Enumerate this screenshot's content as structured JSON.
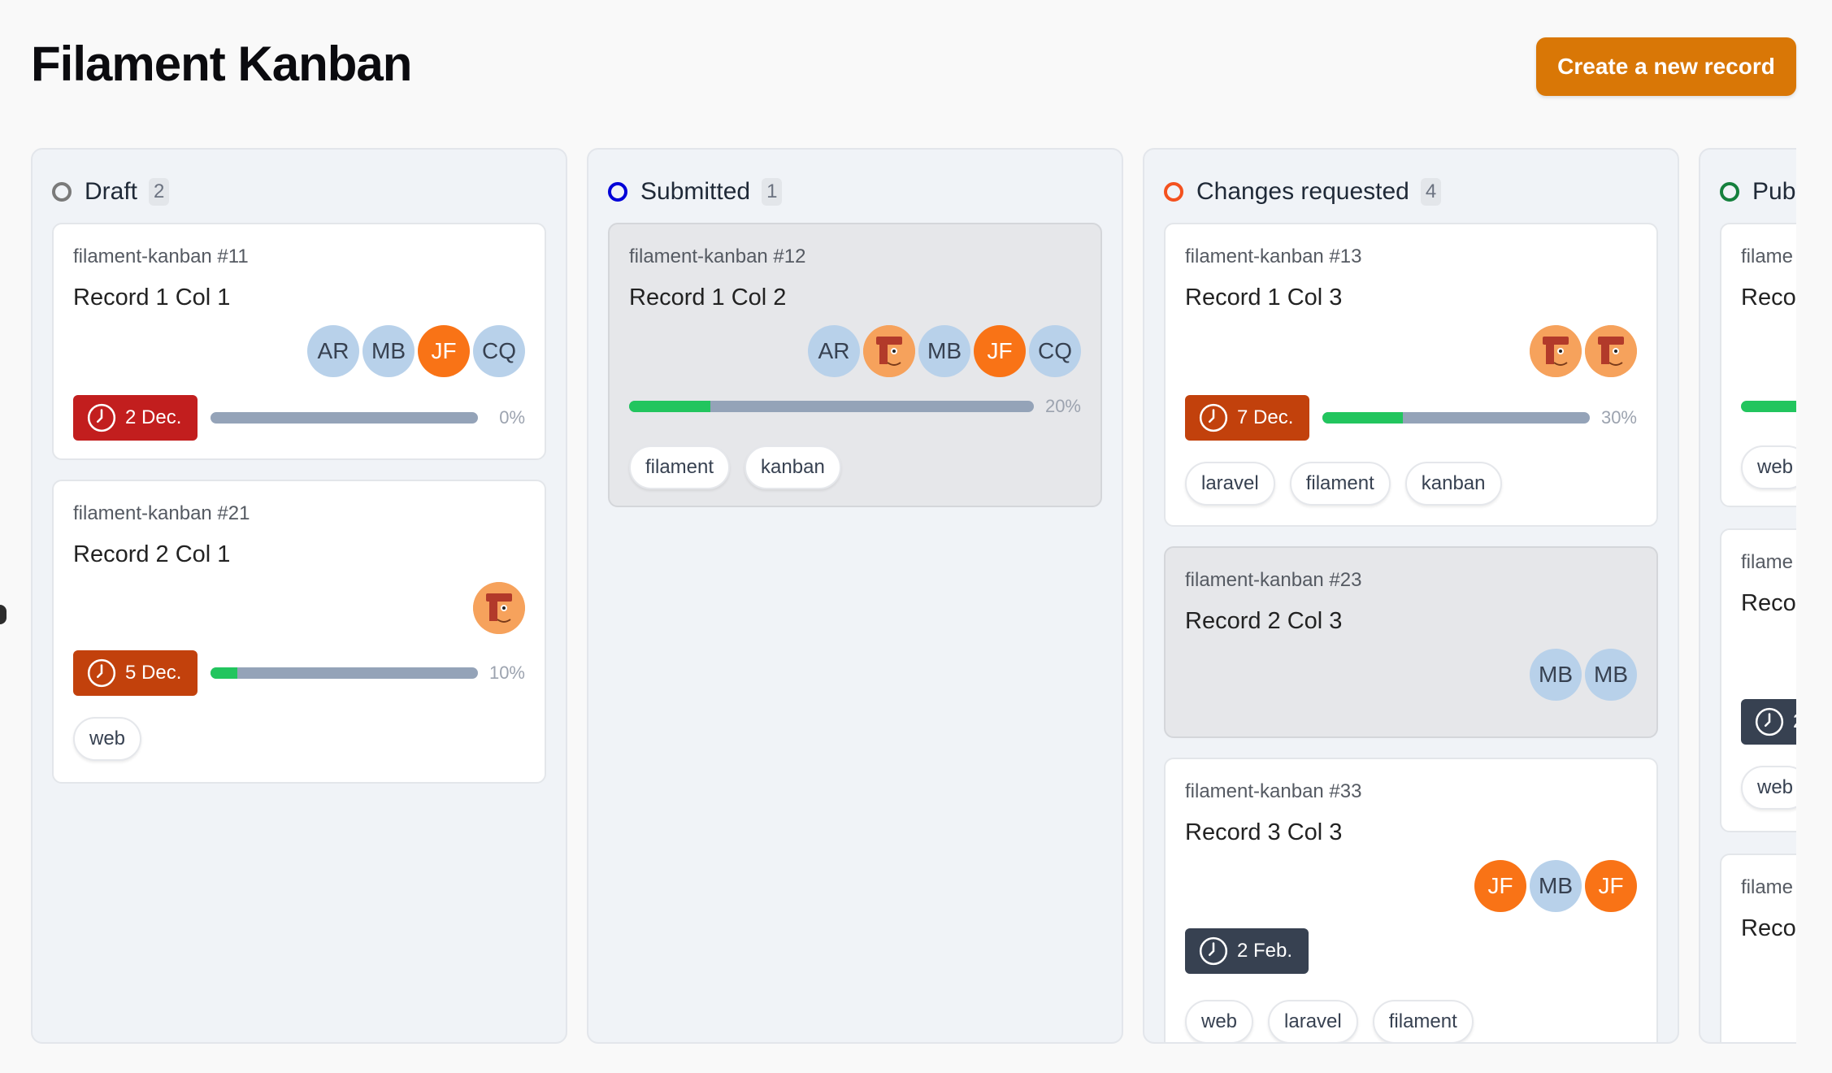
{
  "page": {
    "title": "Filament Kanban",
    "create_label": "Create a new record"
  },
  "columns": [
    {
      "title": "Draft",
      "count": "2",
      "ring_color": "#7a7a7a",
      "cards": [
        {
          "id": "filament-kanban #11",
          "title": "Record 1 Col 1",
          "avatars": [
            "AR",
            "MB",
            "JF",
            "CQ"
          ],
          "due": "2 Dec.",
          "due_color": "#c21e1e",
          "progress": 0,
          "progress_label": "0%",
          "tags": []
        },
        {
          "id": "filament-kanban #21",
          "title": "Record 2 Col 1",
          "avatars": [
            "photo"
          ],
          "due": "5 Dec.",
          "due_color": "#c2410c",
          "progress": 10,
          "progress_label": "10%",
          "tags": [
            "web"
          ]
        }
      ]
    },
    {
      "title": "Submitted",
      "count": "1",
      "ring_color": "#0000d8",
      "cards": [
        {
          "id": "filament-kanban #12",
          "title": "Record 1 Col 2",
          "avatars": [
            "AR",
            "photo",
            "MB",
            "JF",
            "CQ"
          ],
          "due": "",
          "progress": 20,
          "progress_label": "20%",
          "tags": [
            "filament",
            "kanban"
          ]
        }
      ]
    },
    {
      "title": "Changes requested",
      "count": "4",
      "ring_color": "#f4511e",
      "cards": [
        {
          "id": "filament-kanban #13",
          "title": "Record 1 Col 3",
          "avatars": [
            "photo",
            "photo"
          ],
          "due": "7 Dec.",
          "due_color": "#c2410c",
          "progress": 30,
          "progress_label": "30%",
          "tags": [
            "laravel",
            "filament",
            "kanban"
          ]
        },
        {
          "id": "filament-kanban #23",
          "title": "Record 2 Col 3",
          "avatars": [
            "MB",
            "MB"
          ],
          "due": "",
          "tags": []
        },
        {
          "id": "filament-kanban #33",
          "title": "Record 3 Col 3",
          "avatars": [
            "JF",
            "MB",
            "JF"
          ],
          "due": "2 Feb.",
          "due_color": "#374151",
          "tags": [
            "web",
            "laravel",
            "filament"
          ]
        }
      ]
    },
    {
      "title": "Pub",
      "ring_color": "#15803d",
      "cards": [
        {
          "id": "filame",
          "title": "Reco",
          "tags": [
            "web"
          ]
        },
        {
          "id": "filame",
          "title": "Reco",
          "due": "2",
          "due_color": "#374151",
          "tags": [
            "web"
          ]
        },
        {
          "id": "filame",
          "title": "Reco"
        }
      ]
    }
  ]
}
